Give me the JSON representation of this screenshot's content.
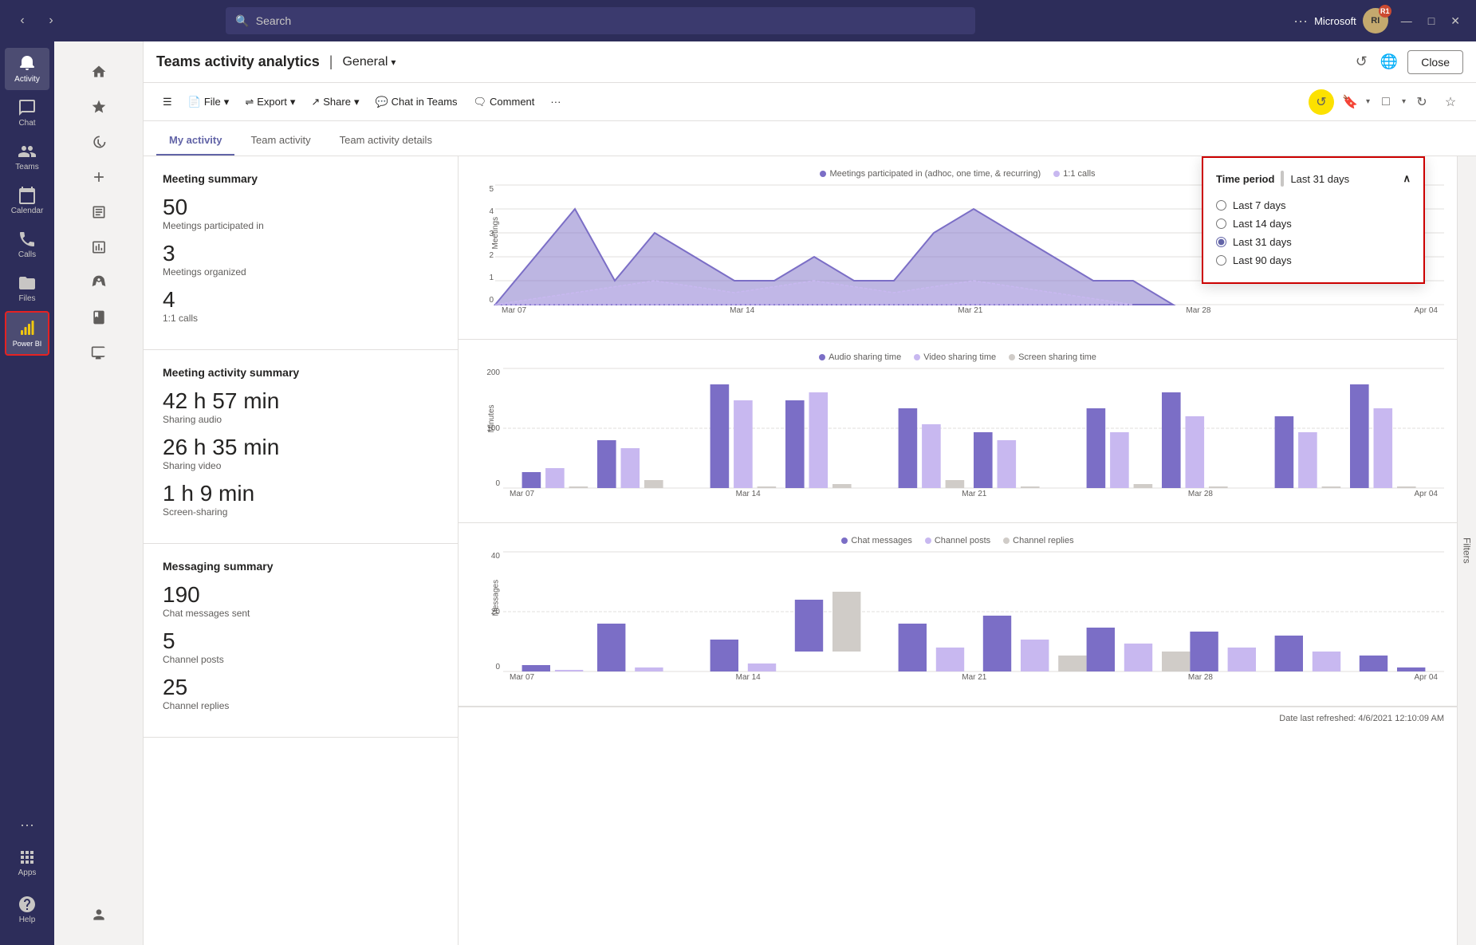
{
  "titleBar": {
    "searchPlaceholder": "Search",
    "orgName": "Microsoft",
    "avatarInitials": "RI",
    "avatarBadge": "R1",
    "windowControls": [
      "—",
      "□",
      "✕"
    ]
  },
  "sidebar": {
    "items": [
      {
        "id": "activity",
        "label": "Activity",
        "icon": "bell"
      },
      {
        "id": "chat",
        "label": "Chat",
        "icon": "chat"
      },
      {
        "id": "teams",
        "label": "Teams",
        "icon": "teams"
      },
      {
        "id": "calendar",
        "label": "Calendar",
        "icon": "calendar"
      },
      {
        "id": "calls",
        "label": "Calls",
        "icon": "calls"
      },
      {
        "id": "files",
        "label": "Files",
        "icon": "files"
      },
      {
        "id": "powerbi",
        "label": "Power BI",
        "icon": "powerbi",
        "active": true
      }
    ],
    "bottomItems": [
      {
        "id": "apps",
        "label": "Apps",
        "icon": "apps"
      },
      {
        "id": "help",
        "label": "Help",
        "icon": "help"
      }
    ]
  },
  "secondarySidebar": {
    "items": [
      {
        "id": "home",
        "icon": "home"
      },
      {
        "id": "favorites",
        "icon": "star"
      },
      {
        "id": "recent",
        "icon": "clock"
      },
      {
        "id": "add",
        "icon": "plus"
      },
      {
        "id": "workspace",
        "icon": "workspace"
      },
      {
        "id": "reports",
        "icon": "chart"
      },
      {
        "id": "rocket",
        "icon": "rocket"
      },
      {
        "id": "book",
        "icon": "book"
      },
      {
        "id": "monitor",
        "icon": "monitor"
      },
      {
        "id": "person",
        "icon": "person"
      }
    ]
  },
  "pageHeader": {
    "title": "Teams activity analytics",
    "divider": "|",
    "subtitle": "General",
    "closeLabel": "Close"
  },
  "toolbar": {
    "fileLabel": "File",
    "exportLabel": "Export",
    "shareLabel": "Share",
    "chatInTeamsLabel": "Chat in Teams",
    "commentLabel": "Comment",
    "moreLabel": "···"
  },
  "tabs": {
    "items": [
      {
        "id": "my-activity",
        "label": "My activity",
        "active": true
      },
      {
        "id": "team-activity",
        "label": "Team activity"
      },
      {
        "id": "team-activity-details",
        "label": "Team activity details"
      }
    ]
  },
  "filterPanel": {
    "title": "Time period",
    "currentValue": "Last 31 days",
    "options": [
      {
        "label": "Last 7 days",
        "value": "7"
      },
      {
        "label": "Last 14 days",
        "value": "14"
      },
      {
        "label": "Last 31 days",
        "value": "31",
        "selected": true
      },
      {
        "label": "Last 90 days",
        "value": "90"
      }
    ]
  },
  "meetingSummary": {
    "title": "Meeting summary",
    "stats": [
      {
        "value": "50",
        "label": "Meetings participated in"
      },
      {
        "value": "3",
        "label": "Meetings organized"
      },
      {
        "value": "4",
        "label": "1:1 calls"
      }
    ],
    "chart": {
      "legend": [
        {
          "label": "Meetings participated in (adhoc, one time, & recurring)",
          "color": "#7b6ec6"
        },
        {
          "label": "1:1 calls",
          "color": "#c8b8f0"
        }
      ],
      "xLabels": [
        "Mar 07",
        "Mar 14",
        "Mar 21",
        "Mar 28",
        "Apr 04"
      ],
      "yMax": 5
    }
  },
  "meetingActivitySummary": {
    "title": "Meeting activity summary",
    "stats": [
      {
        "value": "42 h 57 min",
        "label": "Sharing audio"
      },
      {
        "value": "26 h 35 min",
        "label": "Sharing video"
      },
      {
        "value": "1 h 9 min",
        "label": "Screen-sharing"
      }
    ],
    "chart": {
      "legend": [
        {
          "label": "Audio sharing time",
          "color": "#7b6ec6"
        },
        {
          "label": "Video sharing time",
          "color": "#c8b8f0"
        },
        {
          "label": "Screen sharing time",
          "color": "#d0ccc8"
        }
      ],
      "xLabels": [
        "Mar 07",
        "Mar 14",
        "Mar 21",
        "Mar 28",
        "Apr 04"
      ],
      "yMax": 200
    }
  },
  "messagingSummary": {
    "title": "Messaging summary",
    "stats": [
      {
        "value": "190",
        "label": "Chat messages sent"
      },
      {
        "value": "5",
        "label": "Channel posts"
      },
      {
        "value": "25",
        "label": "Channel replies"
      }
    ],
    "chart": {
      "legend": [
        {
          "label": "Chat messages",
          "color": "#7b6ec6"
        },
        {
          "label": "Channel posts",
          "color": "#c8b8f0"
        },
        {
          "label": "Channel replies",
          "color": "#d0ccc8"
        }
      ],
      "xLabels": [
        "Mar 07",
        "Mar 14",
        "Mar 21",
        "Mar 28",
        "Apr 04"
      ],
      "yMax": 40
    }
  },
  "dateRefreshed": "Date last refreshed: 4/6/2021 12:10:09 AM",
  "filtersTabLabel": "Filters"
}
